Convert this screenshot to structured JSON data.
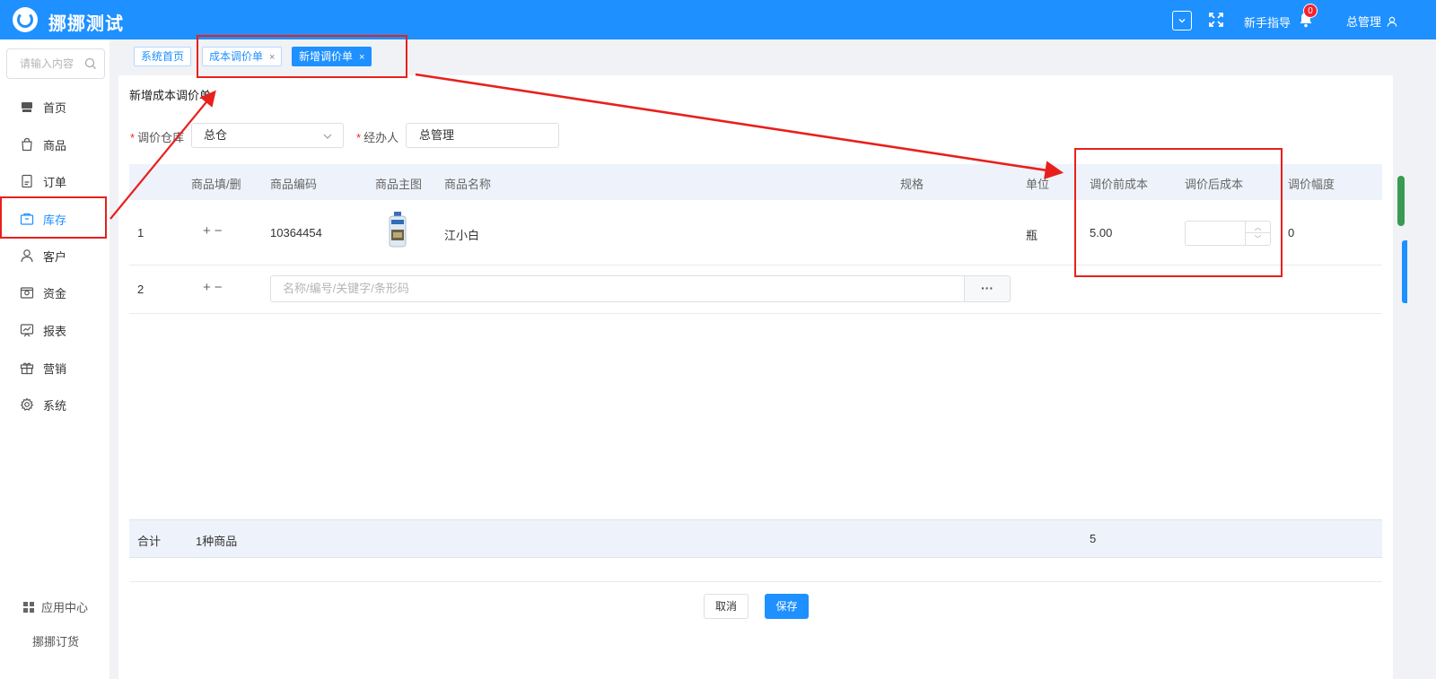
{
  "app": {
    "name": "挪挪测试"
  },
  "topbar": {
    "guide_label": "新手指导",
    "notification_count": "0",
    "user_label": "总管理"
  },
  "sidebar": {
    "search_placeholder": "请输入内容",
    "items": [
      {
        "label": "首页",
        "icon": "shop-icon"
      },
      {
        "label": "商品",
        "icon": "bag-icon"
      },
      {
        "label": "订单",
        "icon": "order-icon"
      },
      {
        "label": "库存",
        "icon": "inventory-icon",
        "active": true
      },
      {
        "label": "客户",
        "icon": "user-icon"
      },
      {
        "label": "资金",
        "icon": "wallet-icon"
      },
      {
        "label": "报表",
        "icon": "chart-board-icon"
      },
      {
        "label": "营销",
        "icon": "gift-icon"
      },
      {
        "label": "系统",
        "icon": "gear-icon"
      }
    ],
    "app_center_label": "应用中心",
    "footer_label": "挪挪订货"
  },
  "tabs": [
    {
      "label": "系统首页",
      "closable": false,
      "active": false
    },
    {
      "label": "成本调价单",
      "closable": true,
      "active": false
    },
    {
      "label": "新增调价单",
      "closable": true,
      "active": true
    }
  ],
  "page": {
    "title": "新增成本调价单",
    "warehouse_label": "调价仓库",
    "warehouse_value": "总仓",
    "operator_label": "经办人",
    "operator_value": "总管理"
  },
  "table": {
    "columns": [
      "商品填/删",
      "商品编码",
      "商品主图",
      "商品名称",
      "规格",
      "单位",
      "调价前成本",
      "调价后成本",
      "调价幅度"
    ],
    "rows": [
      {
        "index": "1",
        "code": "10364454",
        "name": "江小白",
        "spec": "",
        "unit": "瓶",
        "cost_before": "5.00",
        "cost_after": "",
        "change": "0"
      }
    ],
    "new_row": {
      "index": "2",
      "search_placeholder": "名称/编号/关键字/条形码",
      "more_label": "···"
    },
    "footer": {
      "label": "合计",
      "count": "1种商品",
      "cost_before_total": "5"
    }
  },
  "actions": {
    "cancel_label": "取消",
    "save_label": "保存"
  },
  "colors": {
    "primary": "#1e90ff",
    "annotation_red": "#e8201c",
    "header_bg": "#eef2fa"
  }
}
